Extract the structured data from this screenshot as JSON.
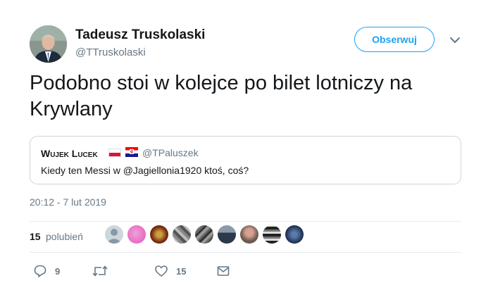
{
  "author": {
    "name": "Tadeusz Truskolaski",
    "handle": "@TTruskolaski",
    "avatar_icon": "profile-photo-man-in-suit"
  },
  "follow_button_label": "Obserwuj",
  "tweet_text": "Podobno stoi w kolejce po bilet lotniczy na Krywlany",
  "quoted_tweet": {
    "name": "Wujek Lucek",
    "flags": [
      "poland-flag-icon",
      "croatia-flag-icon"
    ],
    "handle": "@TPaluszek",
    "text": "Kiedy ten Messi w @Jagiellonia1920 ktoś, coś?"
  },
  "timestamp": "20:12 - 7 lut 2019",
  "likes": {
    "count": "15",
    "label": "polubień",
    "liker_avatars": 9
  },
  "actions": {
    "reply_count": "9",
    "retweet_count": "",
    "like_count": "15"
  },
  "colors": {
    "accent": "#1da1f2",
    "secondary_text": "#657786",
    "border": "#ccd6dd"
  }
}
